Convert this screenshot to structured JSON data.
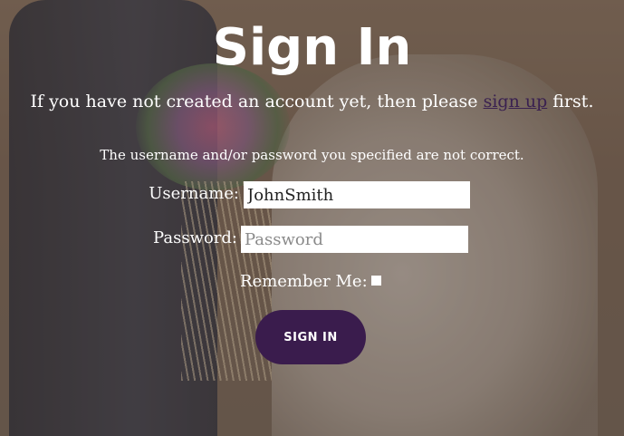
{
  "page": {
    "title": "Sign In",
    "subtitle_prefix": "If you have not created an account yet, then please",
    "subtitle_link": "sign up",
    "subtitle_suffix": "first.",
    "error_message": "The username and/or password you specified are not correct."
  },
  "form": {
    "username_label": "Username:",
    "username_value": "JohnSmith",
    "password_label": "Password:",
    "password_placeholder": "Password",
    "remember_label": "Remember Me:",
    "remember_checked": false,
    "submit_label": "SIGN IN"
  },
  "colors": {
    "button_bg": "#3a1c4d",
    "link": "#3a2150",
    "text": "#ffffff"
  }
}
